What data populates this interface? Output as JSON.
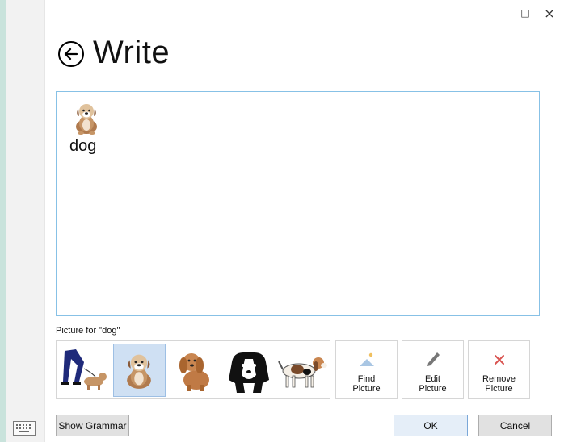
{
  "window": {
    "maximize_glyph": "□",
    "close_glyph": "×"
  },
  "header": {
    "title": "Write"
  },
  "editor": {
    "word": "dog"
  },
  "picture_panel": {
    "caption": "Picture for \"dog\"",
    "thumbnails": [
      "dog-walking-icon",
      "sitting-dog-icon",
      "brown-dog-icon",
      "black-white-dog-icon",
      "beagle-icon"
    ],
    "selected_index": 1
  },
  "actions": {
    "find_line1": "Find",
    "find_line2": "Picture",
    "edit_line1": "Edit",
    "edit_line2": "Picture",
    "remove_line1": "Remove",
    "remove_line2": "Picture"
  },
  "footer": {
    "show_grammar": "Show Grammar",
    "ok": "OK",
    "cancel": "Cancel"
  },
  "colors": {
    "editor_border": "#87c1e6",
    "selection_bg": "#cfe0f3",
    "remove_icon": "#d9534f",
    "find_icon": "#a9c6e3"
  }
}
